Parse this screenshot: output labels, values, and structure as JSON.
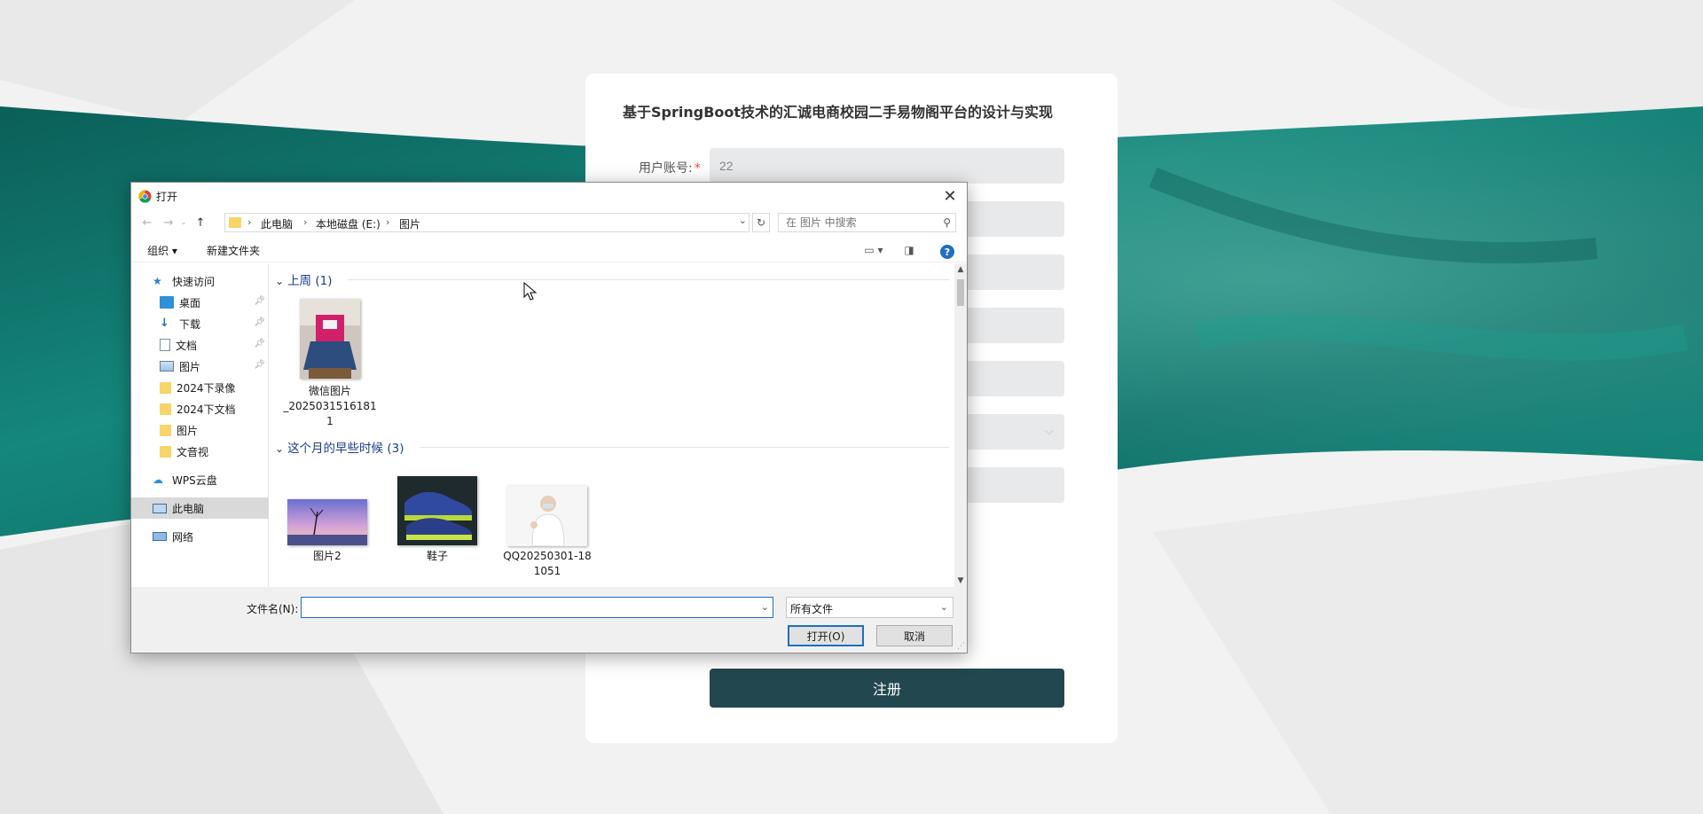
{
  "page": {
    "background_colors": {
      "teal": "#0f6e66",
      "light": "#f4f4f4",
      "card": "#ffffff",
      "accent": "#23474f"
    }
  },
  "form": {
    "title": "基于SpringBoot技术的汇诚电商校园二手易物阁平台的设计与实现",
    "account_label": "用户账号:",
    "required_mark": "*",
    "account_value": "22",
    "register_label": "注册"
  },
  "dialog": {
    "title": "打开",
    "close_icon": "close-icon",
    "breadcrumb": [
      "此电脑",
      "本地磁盘 (E:)",
      "图片"
    ],
    "search_placeholder": "在 图片 中搜索",
    "toolbar": {
      "organize": "组织 ▾",
      "new_folder": "新建文件夹"
    },
    "help_glyph": "?",
    "sidebar": {
      "quick_access": "快速访问",
      "items": [
        {
          "label": "桌面",
          "icon": "desktop-icon",
          "pinned": true
        },
        {
          "label": "下载",
          "icon": "download-icon",
          "pinned": true
        },
        {
          "label": "文档",
          "icon": "document-icon",
          "pinned": true
        },
        {
          "label": "图片",
          "icon": "pictures-icon",
          "pinned": true
        },
        {
          "label": "2024下录像",
          "icon": "folder-icon",
          "pinned": false
        },
        {
          "label": "2024下文档",
          "icon": "folder-icon",
          "pinned": false
        },
        {
          "label": "图片",
          "icon": "folder-icon",
          "pinned": false
        },
        {
          "label": "文音视",
          "icon": "folder-icon",
          "pinned": false
        }
      ],
      "wps": "WPS云盘",
      "this_pc": "此电脑",
      "network": "网络"
    },
    "groups": [
      {
        "header": "上周 (1)",
        "files": [
          {
            "name_line1": "微信图片",
            "name_line2": "_2025031516181",
            "name_line3": "1"
          }
        ]
      },
      {
        "header": "这个月的早些时候 (3)",
        "files": [
          {
            "name_line1": "图片2",
            "name_line2": ""
          },
          {
            "name_line1": "鞋子",
            "name_line2": ""
          },
          {
            "name_line1": "QQ20250301-18",
            "name_line2": "1051"
          }
        ]
      }
    ],
    "filename_label": "文件名(N):",
    "filename_value": "",
    "filetype_value": "所有文件",
    "open_button": "打开(O)",
    "cancel_button": "取消"
  }
}
